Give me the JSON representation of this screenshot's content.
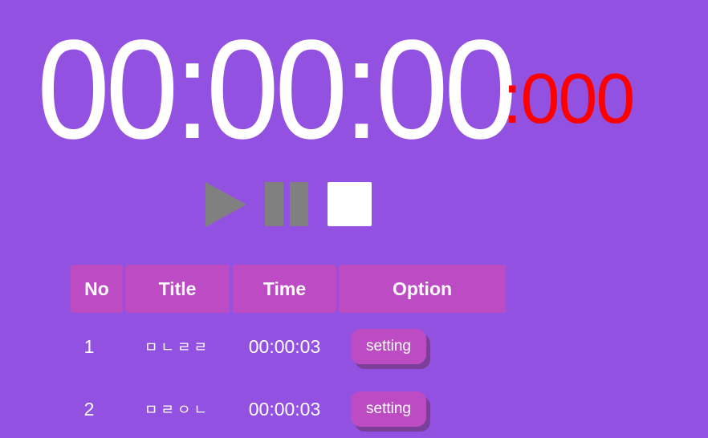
{
  "timer": {
    "main": "00:00:00",
    "ms": ":000"
  },
  "controls": {
    "play_icon": "play-icon",
    "pause_icon": "pause-icon",
    "stop_icon": "stop-icon",
    "play_color": "#808080",
    "pause_color": "#808080",
    "stop_color": "#ffffff"
  },
  "table": {
    "headers": {
      "no": "No",
      "title": "Title",
      "time": "Time",
      "option": "Option"
    },
    "rows": [
      {
        "no": "1",
        "title": "ㅁㄴㄹㄹ",
        "time": "00:00:03",
        "option": "setting"
      },
      {
        "no": "2",
        "title": "ㅁㄹㅇㄴ",
        "time": "00:00:03",
        "option": "setting"
      }
    ]
  },
  "colors": {
    "background": "#9351e2",
    "accent": "#bd4cc4",
    "ms_color": "#ff0000"
  }
}
